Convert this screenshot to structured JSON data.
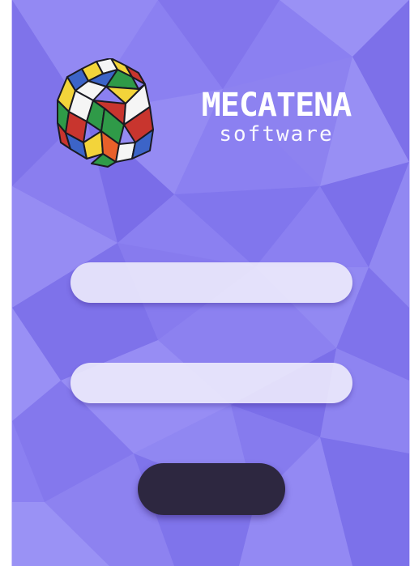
{
  "brand": {
    "title": "MECATENA",
    "subtitle": "software",
    "logo_icon": "rubiks-cube-icon"
  },
  "form": {
    "username": {
      "value": "",
      "placeholder": ""
    },
    "password": {
      "value": "",
      "placeholder": ""
    },
    "submit_label": ""
  },
  "colors": {
    "background": "#8a7ef0",
    "field": "#eeecfa",
    "button": "#2d2740"
  }
}
